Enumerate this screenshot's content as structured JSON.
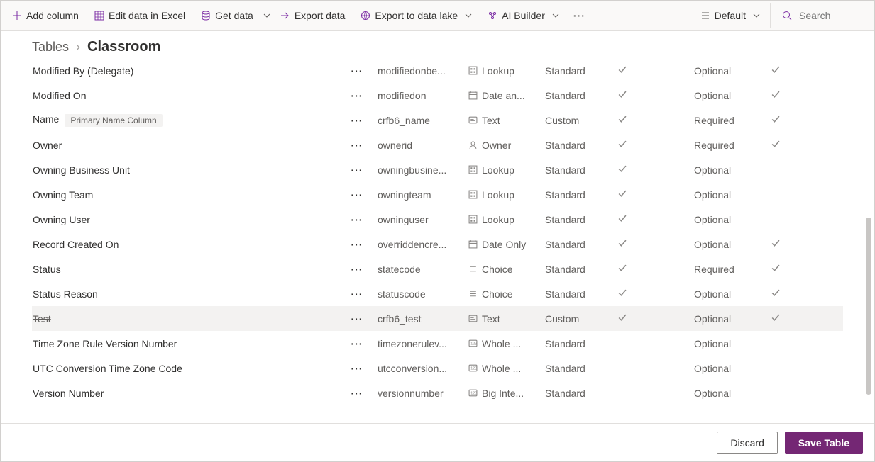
{
  "toolbar": {
    "add_column": "Add column",
    "edit_excel": "Edit data in Excel",
    "get_data": "Get data",
    "export_data": "Export data",
    "export_lake": "Export to data lake",
    "ai_builder": "AI Builder",
    "view_name": "Default",
    "search_placeholder": "Search"
  },
  "breadcrumb": {
    "root": "Tables",
    "current": "Classroom"
  },
  "pill_primary_name": "Primary Name Column",
  "rows": [
    {
      "display": "Modified By (Delegate)",
      "schema": "modifiedonbe...",
      "type": "Lookup",
      "typeicon": "lookup",
      "category": "Standard",
      "check1": true,
      "required": "Optional",
      "check2": true,
      "strike": false
    },
    {
      "display": "Modified On",
      "schema": "modifiedon",
      "type": "Date an...",
      "typeicon": "date",
      "category": "Standard",
      "check1": true,
      "required": "Optional",
      "check2": true,
      "strike": false
    },
    {
      "display": "Name",
      "schema": "crfb6_name",
      "type": "Text",
      "typeicon": "text",
      "category": "Custom",
      "check1": true,
      "required": "Required",
      "check2": true,
      "strike": false,
      "pill": true
    },
    {
      "display": "Owner",
      "schema": "ownerid",
      "type": "Owner",
      "typeicon": "owner",
      "category": "Standard",
      "check1": true,
      "required": "Required",
      "check2": true,
      "strike": false
    },
    {
      "display": "Owning Business Unit",
      "schema": "owningbusine...",
      "type": "Lookup",
      "typeicon": "lookup",
      "category": "Standard",
      "check1": true,
      "required": "Optional",
      "check2": false,
      "strike": false
    },
    {
      "display": "Owning Team",
      "schema": "owningteam",
      "type": "Lookup",
      "typeicon": "lookup",
      "category": "Standard",
      "check1": true,
      "required": "Optional",
      "check2": false,
      "strike": false
    },
    {
      "display": "Owning User",
      "schema": "owninguser",
      "type": "Lookup",
      "typeicon": "lookup",
      "category": "Standard",
      "check1": true,
      "required": "Optional",
      "check2": false,
      "strike": false
    },
    {
      "display": "Record Created On",
      "schema": "overriddencre...",
      "type": "Date Only",
      "typeicon": "date",
      "category": "Standard",
      "check1": true,
      "required": "Optional",
      "check2": true,
      "strike": false
    },
    {
      "display": "Status",
      "schema": "statecode",
      "type": "Choice",
      "typeicon": "choice",
      "category": "Standard",
      "check1": true,
      "required": "Required",
      "check2": true,
      "strike": false
    },
    {
      "display": "Status Reason",
      "schema": "statuscode",
      "type": "Choice",
      "typeicon": "choice",
      "category": "Standard",
      "check1": true,
      "required": "Optional",
      "check2": true,
      "strike": false
    },
    {
      "display": "Test",
      "schema": "crfb6_test",
      "type": "Text",
      "typeicon": "text",
      "category": "Custom",
      "check1": true,
      "required": "Optional",
      "check2": true,
      "strike": true,
      "highlight": true
    },
    {
      "display": "Time Zone Rule Version Number",
      "schema": "timezonerulev...",
      "type": "Whole ...",
      "typeicon": "number",
      "category": "Standard",
      "check1": false,
      "required": "Optional",
      "check2": false,
      "strike": false
    },
    {
      "display": "UTC Conversion Time Zone Code",
      "schema": "utcconversion...",
      "type": "Whole ...",
      "typeicon": "number",
      "category": "Standard",
      "check1": false,
      "required": "Optional",
      "check2": false,
      "strike": false
    },
    {
      "display": "Version Number",
      "schema": "versionnumber",
      "type": "Big Inte...",
      "typeicon": "number",
      "category": "Standard",
      "check1": false,
      "required": "Optional",
      "check2": false,
      "strike": false
    }
  ],
  "footer": {
    "discard": "Discard",
    "save": "Save Table"
  }
}
